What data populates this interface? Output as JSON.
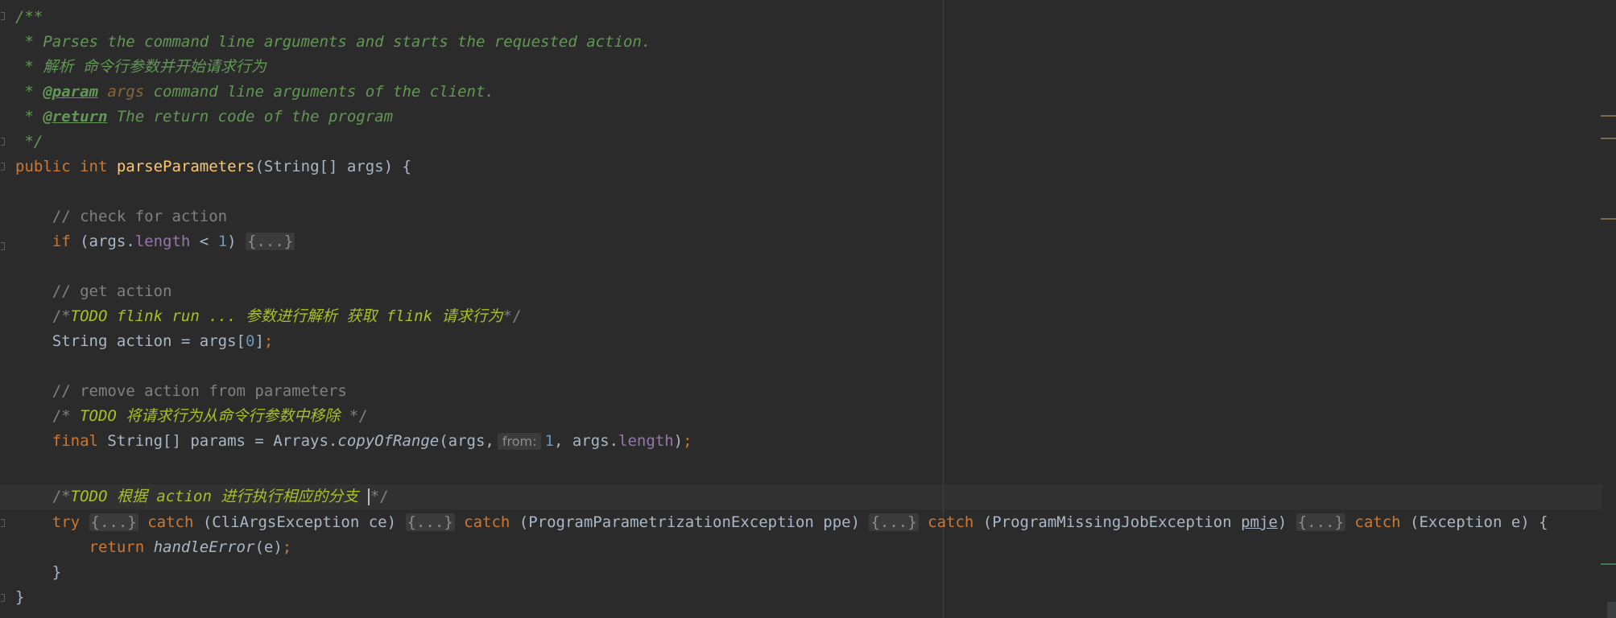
{
  "colors": {
    "background": "#2b2b2b",
    "keyword": "#cc7832",
    "doc_comment": "#629755",
    "line_comment": "#808080",
    "todo": "#a8c023",
    "method_decl": "#ffc66d",
    "number": "#6897bb",
    "field": "#9876aa",
    "default_text": "#a9b7c6"
  },
  "code": {
    "l1": {
      "text": "/**"
    },
    "l2": {
      "text": " * Parses the command line arguments and starts the requested action."
    },
    "l3": {
      "text": " * 解析 命令行参数并开始请求行为"
    },
    "l4": {
      "star": " * ",
      "tag": "@param",
      "param": " args",
      "text": " command line arguments of the client."
    },
    "l5": {
      "star": " * ",
      "tag": "@return",
      "text": " The return code of the program"
    },
    "l6": {
      "text": " */"
    },
    "l7": {
      "kw1": "public",
      "kw2": " int",
      "method": " parseParameters",
      "rest": "(String[] args) {"
    },
    "l9": {
      "comment": "    // check for action"
    },
    "l10": {
      "kw": "    if",
      "a": " (args.",
      "field": "length",
      "b": " < ",
      "num": "1",
      "c": ") ",
      "folded": "{...}"
    },
    "l12": {
      "comment": "    // get action"
    },
    "l13": {
      "open": "    /*",
      "todo": "TODO flink run ... 参数进行解析 获取 flink 请求行为",
      "close": "*/"
    },
    "l14": {
      "a": "    String action = args[",
      "num": "0",
      "b": "]",
      "semi": ";"
    },
    "l16": {
      "comment": "    // remove action from parameters"
    },
    "l17": {
      "open": "    /* ",
      "todo": "TODO 将请求行为从命令行参数中移除",
      "close": " */"
    },
    "l18": {
      "kw": "    final",
      "a": " String[] params = Arrays.",
      "call": "copyOfRange",
      "b": "(args,",
      "hint": "from:",
      "num": "1",
      "c": ", args.",
      "field": "length",
      "d": ")",
      "semi": ";"
    },
    "l20": {
      "open": "    /*",
      "todo": "TODO 根据 action 进行执行相应的分支 ",
      "close": "*/"
    },
    "l21": {
      "kw_try": "    try",
      "fold1": "{...}",
      "catch1": "catch",
      "arg1": " (CliArgsException ce) ",
      "fold2": "{...}",
      "catch2": "catch",
      "arg2": " (ProgramParametrizationException ppe) ",
      "fold3": "{...}",
      "catch3": "catch",
      "arg3a": " (ProgramMissingJobException ",
      "arg3var": "pmje",
      "arg3b": ") ",
      "fold4": "{...}",
      "catch4": "catch",
      "arg4": " (Exception e) {"
    },
    "l22": {
      "kw": "        return",
      "call": " handleError",
      "rest": "(e)",
      "semi": ";"
    },
    "l23": {
      "text": "    }"
    },
    "l24": {
      "text": "}"
    }
  }
}
